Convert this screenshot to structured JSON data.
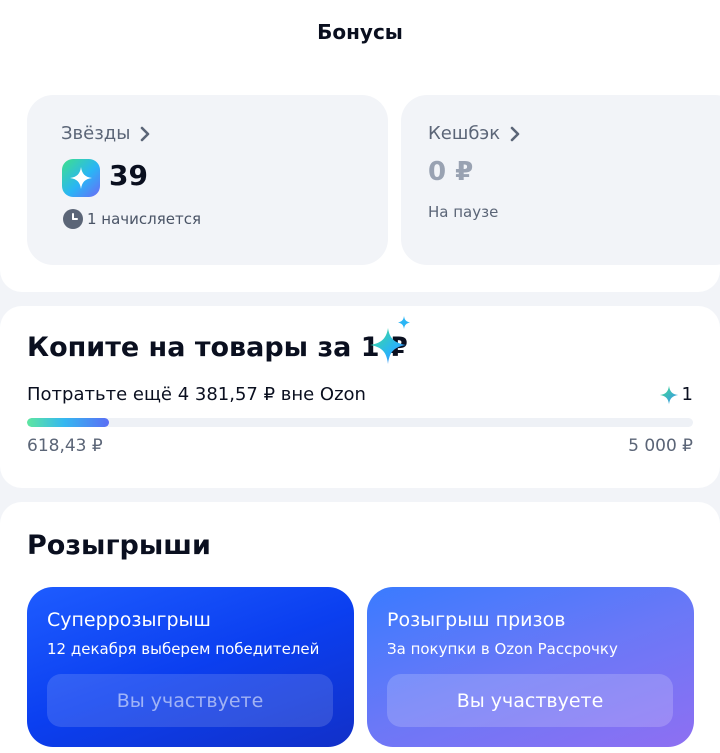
{
  "header": {
    "title": "Бонусы"
  },
  "stars": {
    "label": "Звёзды",
    "value": "39",
    "pending_text": "1 начисляется"
  },
  "cashback": {
    "label": "Кешбэк",
    "value": "0 ₽",
    "status": "На паузе"
  },
  "save": {
    "title": "Копите на товары за 1 ₽",
    "caption": "Потратьте ещё 4 381,57 ₽ вне Ozon",
    "reward_count": "1",
    "progress_current": "618,43 ₽",
    "progress_target": "5 000 ₽",
    "progress_fraction": 0.1237
  },
  "lotteries": {
    "title": "Розыгрыши",
    "items": [
      {
        "title": "Суперрозыгрыш",
        "subtitle": "12 декабря выберем победителей",
        "button_label": "Вы участвуете"
      },
      {
        "title": "Розыгрыш призов",
        "subtitle": "За покупки в Ozon Рассрочку",
        "button_label": "Вы участвуете"
      }
    ]
  },
  "colors": {
    "accent_blue": "#0b3ff0",
    "muted_text": "#5b6577",
    "card_bg": "#f2f4f8"
  }
}
